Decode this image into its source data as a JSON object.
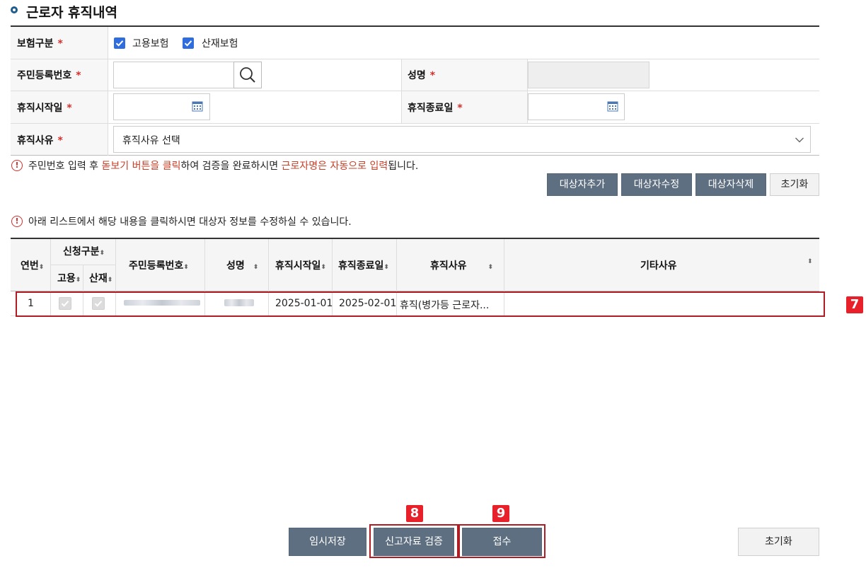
{
  "section": {
    "title": "근로자 휴직내역"
  },
  "form": {
    "insurance_type_label": "보험구분",
    "required_mark": "*",
    "employment_insurance_label": "고용보험",
    "industrial_insurance_label": "산재보험",
    "rrn_label": "주민등록번호",
    "name_label": "성명",
    "leave_start_label": "휴직시작일",
    "leave_end_label": "휴직종료일",
    "leave_reason_label": "휴직사유",
    "leave_reason_selected": "휴직사유 선택"
  },
  "notice1": {
    "part1": "주민번호 입력 후 ",
    "part2": "돋보기 버튼을 클릭",
    "part3": "하여 검증을 완료하시면 ",
    "part4": "근로자명은 자동으로 입력",
    "part5": "됩니다."
  },
  "actions": {
    "add": "대상자추가",
    "edit": "대상자수정",
    "delete": "대상자삭제",
    "reset": "초기화"
  },
  "notice2": "아래 리스트에서 해당 내용을 클릭하시면 대상자 정보를 수정하실 수 있습니다.",
  "table": {
    "headers": {
      "no": "연번",
      "apply_type": "신청구분",
      "employment": "고용",
      "industrial": "산재",
      "rrn": "주민등록번호",
      "name": "성명",
      "start": "휴직시작일",
      "end": "휴직종료일",
      "reason": "휴직사유",
      "other": "기타사유"
    },
    "rows": [
      {
        "no": "1",
        "start": "2025-01-01",
        "end": "2025-02-01",
        "reason": "휴직(병가등 근로자...",
        "other": ""
      }
    ]
  },
  "annotations": {
    "row_badge": "7",
    "verify_badge": "8",
    "submit_badge": "9"
  },
  "footer": {
    "temp_save": "임시저장",
    "verify": "신고자료 검증",
    "submit": "접수",
    "reset": "초기화"
  },
  "colors": {
    "accent": "#1e5c8c",
    "button_dark": "#5f6f82",
    "required": "#d0312d",
    "highlight": "#b01c24",
    "badge": "#e8202a",
    "checkbox": "#2f6dde"
  }
}
